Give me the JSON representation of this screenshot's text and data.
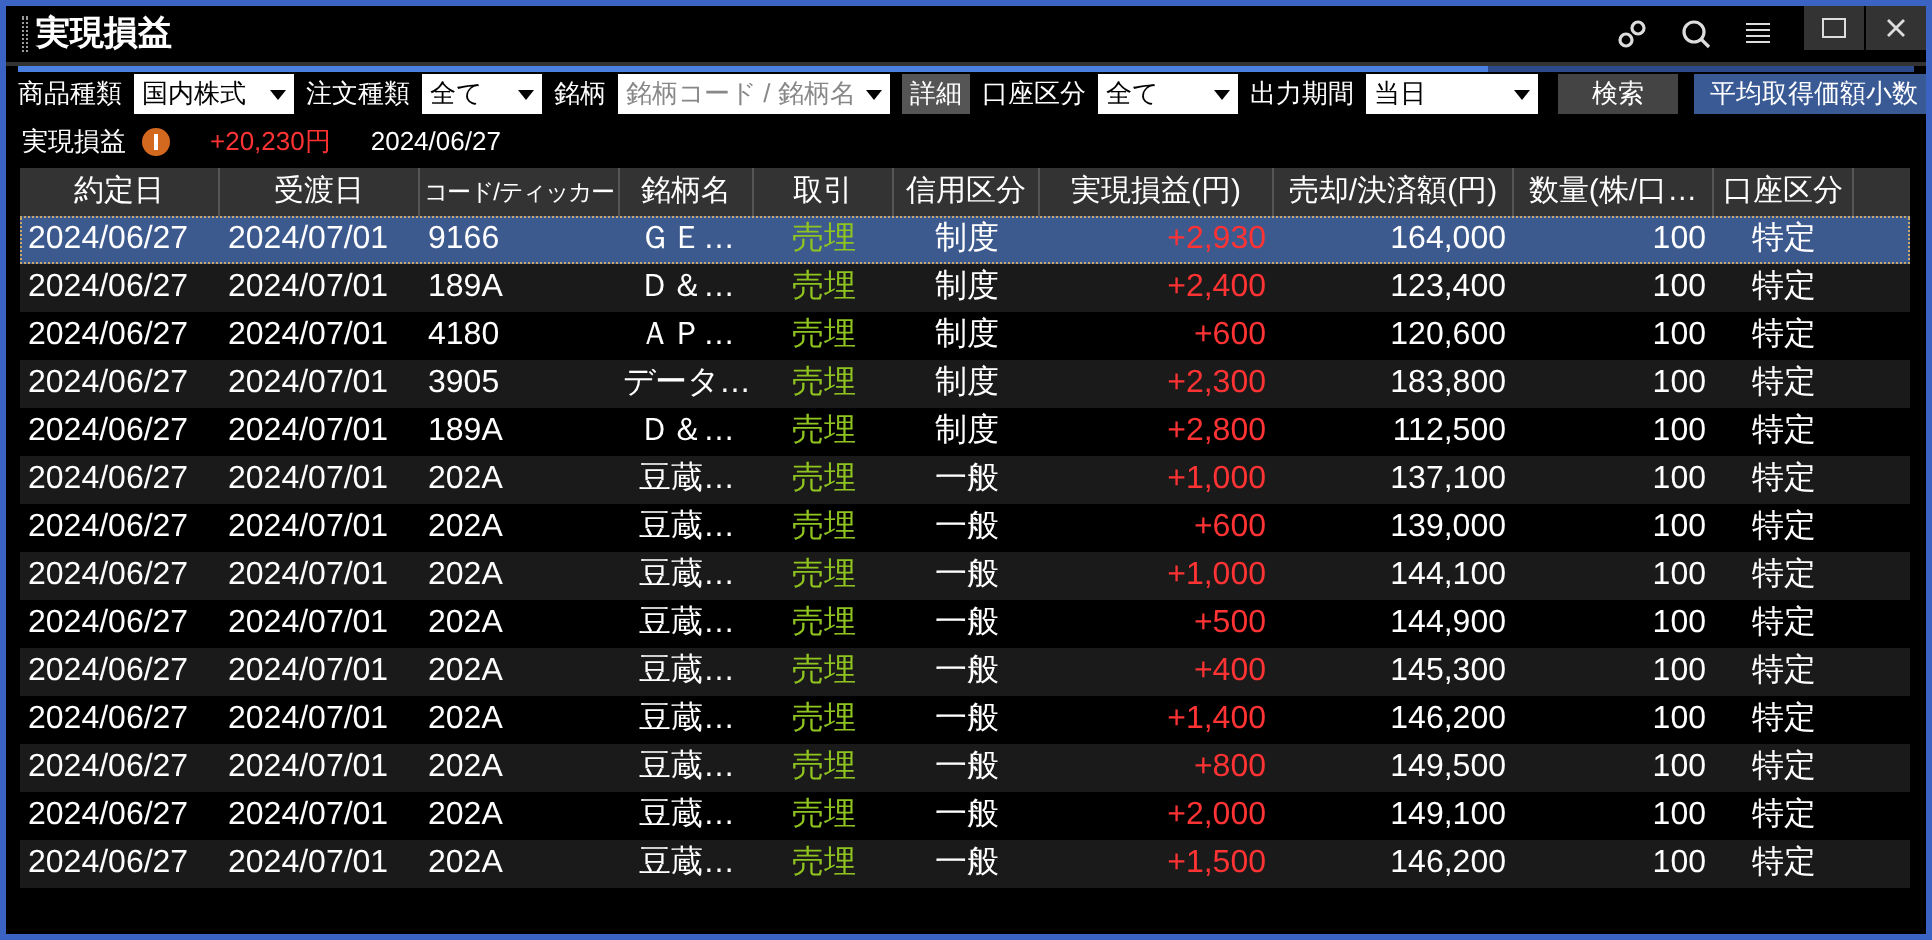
{
  "window": {
    "title": "実現損益"
  },
  "toolbar": {
    "filters": [
      {
        "label": "商品種類",
        "value": "国内株式"
      },
      {
        "label": "注文種類",
        "value": "全て"
      },
      {
        "label": "銘柄",
        "placeholder": "銘柄コード / 銘柄名"
      }
    ],
    "detail_button": "詳細",
    "filters2": [
      {
        "label": "口座区分",
        "value": "全て"
      },
      {
        "label": "出力期間",
        "value": "当日"
      }
    ],
    "search_button": "検索",
    "average_button": "平均取得価額小数"
  },
  "summary": {
    "label": "実現損益",
    "value": "+20,230円",
    "date": "2024/06/27"
  },
  "table": {
    "columns": [
      "約定日",
      "受渡日",
      "コード/ティッカー",
      "銘柄名",
      "取引",
      "信用区分",
      "実現損益(円)",
      "売却/決済額(円)",
      "数量(株/口…",
      "口座区分"
    ],
    "rows": [
      {
        "selected": true,
        "cells": [
          "2024/06/27",
          "2024/07/01",
          "9166",
          "ＧＥ…",
          "売埋",
          "制度",
          "+2,930",
          "164,000",
          "100",
          "特定"
        ]
      },
      {
        "selected": false,
        "cells": [
          "2024/06/27",
          "2024/07/01",
          "189A",
          "Ｄ＆…",
          "売埋",
          "制度",
          "+2,400",
          "123,400",
          "100",
          "特定"
        ]
      },
      {
        "selected": false,
        "cells": [
          "2024/06/27",
          "2024/07/01",
          "4180",
          "ＡＰ…",
          "売埋",
          "制度",
          "+600",
          "120,600",
          "100",
          "特定"
        ]
      },
      {
        "selected": false,
        "cells": [
          "2024/06/27",
          "2024/07/01",
          "3905",
          "データ…",
          "売埋",
          "制度",
          "+2,300",
          "183,800",
          "100",
          "特定"
        ]
      },
      {
        "selected": false,
        "cells": [
          "2024/06/27",
          "2024/07/01",
          "189A",
          "Ｄ＆…",
          "売埋",
          "制度",
          "+2,800",
          "112,500",
          "100",
          "特定"
        ]
      },
      {
        "selected": false,
        "cells": [
          "2024/06/27",
          "2024/07/01",
          "202A",
          "豆蔵…",
          "売埋",
          "一般",
          "+1,000",
          "137,100",
          "100",
          "特定"
        ]
      },
      {
        "selected": false,
        "cells": [
          "2024/06/27",
          "2024/07/01",
          "202A",
          "豆蔵…",
          "売埋",
          "一般",
          "+600",
          "139,000",
          "100",
          "特定"
        ]
      },
      {
        "selected": false,
        "cells": [
          "2024/06/27",
          "2024/07/01",
          "202A",
          "豆蔵…",
          "売埋",
          "一般",
          "+1,000",
          "144,100",
          "100",
          "特定"
        ]
      },
      {
        "selected": false,
        "cells": [
          "2024/06/27",
          "2024/07/01",
          "202A",
          "豆蔵…",
          "売埋",
          "一般",
          "+500",
          "144,900",
          "100",
          "特定"
        ]
      },
      {
        "selected": false,
        "cells": [
          "2024/06/27",
          "2024/07/01",
          "202A",
          "豆蔵…",
          "売埋",
          "一般",
          "+400",
          "145,300",
          "100",
          "特定"
        ]
      },
      {
        "selected": false,
        "cells": [
          "2024/06/27",
          "2024/07/01",
          "202A",
          "豆蔵…",
          "売埋",
          "一般",
          "+1,400",
          "146,200",
          "100",
          "特定"
        ]
      },
      {
        "selected": false,
        "cells": [
          "2024/06/27",
          "2024/07/01",
          "202A",
          "豆蔵…",
          "売埋",
          "一般",
          "+800",
          "149,500",
          "100",
          "特定"
        ]
      },
      {
        "selected": false,
        "cells": [
          "2024/06/27",
          "2024/07/01",
          "202A",
          "豆蔵…",
          "売埋",
          "一般",
          "+2,000",
          "149,100",
          "100",
          "特定"
        ]
      },
      {
        "selected": false,
        "cells": [
          "2024/06/27",
          "2024/07/01",
          "202A",
          "豆蔵…",
          "売埋",
          "一般",
          "+1,500",
          "146,200",
          "100",
          "特定"
        ]
      }
    ]
  }
}
